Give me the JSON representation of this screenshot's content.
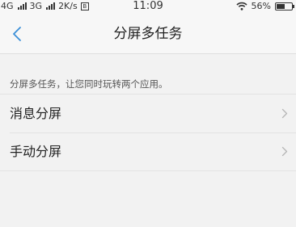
{
  "status_bar": {
    "sim1": "4G",
    "sim2": "3G",
    "speed": "2K/s",
    "notify_badge": "B",
    "time": "11:09",
    "battery_level": "56%",
    "battery_fraction": 0.56
  },
  "header": {
    "title": "分屏多任务",
    "back_icon": "chevron-left-icon"
  },
  "description": "分屏多任务，让您同时玩转两个应用。",
  "settings": {
    "items": [
      {
        "label": "消息分屏",
        "icon": "chevron-right-icon"
      },
      {
        "label": "手动分屏",
        "icon": "chevron-right-icon"
      }
    ]
  },
  "colors": {
    "accent": "#3b8fd8",
    "background": "#f2f2f2",
    "chevron": "#b5b5b5"
  }
}
